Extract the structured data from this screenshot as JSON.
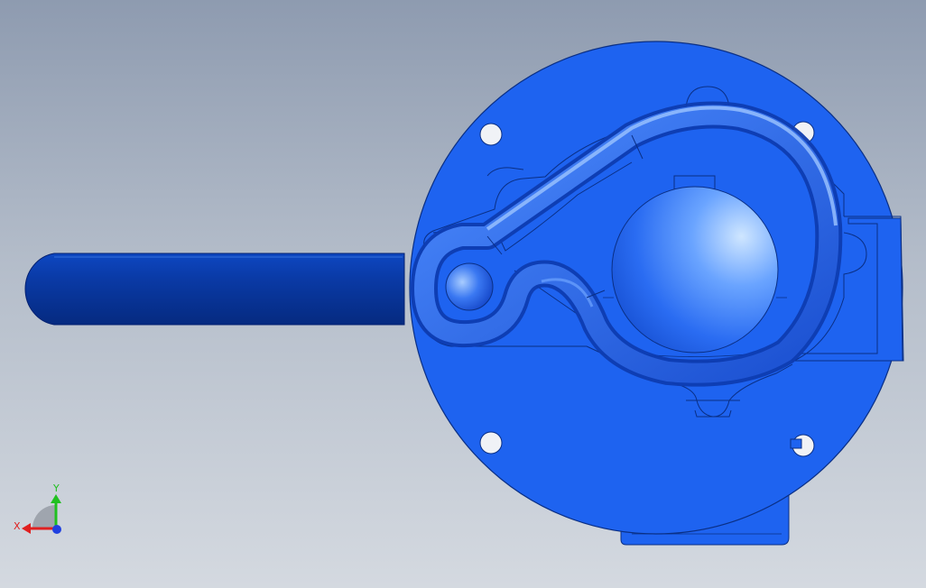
{
  "viewport": {
    "background_top": "#8e9bb0",
    "background_bottom": "#d4d9e0"
  },
  "model": {
    "body_color": "#1e63f0",
    "shaft_color": "#0b3fa8",
    "edge_color": "#0a2f85",
    "highlight_color": "#8fc0ff"
  },
  "triad": {
    "x_label": "X",
    "y_label": "Y",
    "x_color": "#e02020",
    "y_color": "#20c020",
    "z_color": "#2040e0"
  }
}
